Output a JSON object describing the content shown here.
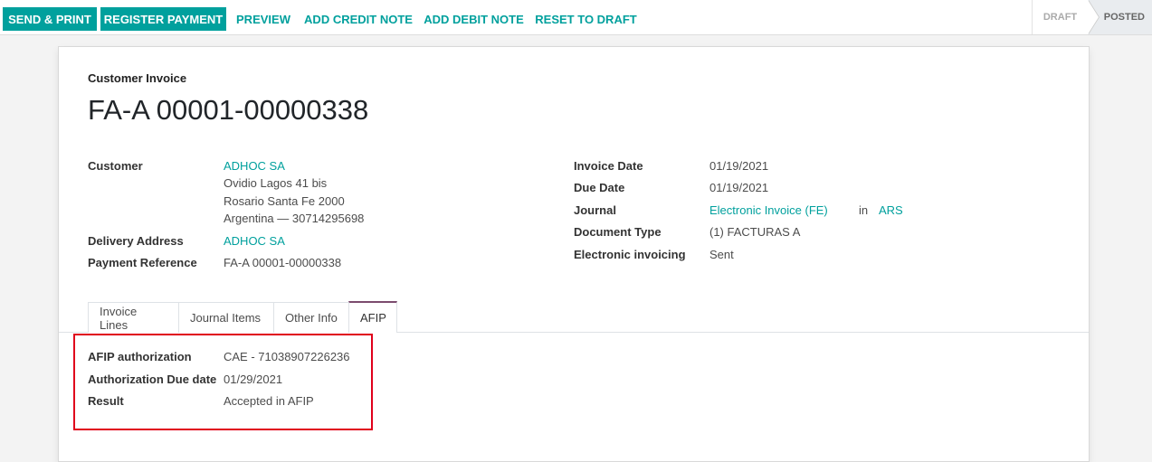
{
  "toolbar": {
    "send_print": "SEND & PRINT",
    "register_payment": "REGISTER PAYMENT",
    "preview": "PREVIEW",
    "add_credit_note": "ADD CREDIT NOTE",
    "add_debit_note": "ADD DEBIT NOTE",
    "reset_to_draft": "RESET TO DRAFT"
  },
  "status": {
    "stages": [
      "DRAFT",
      "POSTED"
    ],
    "current": "POSTED"
  },
  "invoice": {
    "kind": "Customer Invoice",
    "name": "FA-A 00001-00000338"
  },
  "left_fields": {
    "customer_label": "Customer",
    "customer_name": "ADHOC SA",
    "address_line1": "Ovidio Lagos 41 bis",
    "address_line2": "Rosario Santa Fe 2000",
    "address_line3": "Argentina — 30714295698",
    "delivery_label": "Delivery Address",
    "delivery_value": "ADHOC SA",
    "payment_ref_label": "Payment Reference",
    "payment_ref_value": "FA-A 00001-00000338"
  },
  "right_fields": {
    "invoice_date_label": "Invoice Date",
    "invoice_date_value": "01/19/2021",
    "due_date_label": "Due Date",
    "due_date_value": "01/19/2021",
    "journal_label": "Journal",
    "journal_value": "Electronic Invoice (FE)",
    "journal_in": "in",
    "currency": "ARS",
    "doc_type_label": "Document Type",
    "doc_type_value": "(1) FACTURAS A",
    "einvoicing_label": "Electronic invoicing",
    "einvoicing_value": "Sent"
  },
  "tabs": {
    "invoice_lines": "Invoice Lines",
    "journal_items": "Journal Items",
    "other_info": "Other Info",
    "afip": "AFIP",
    "active": "AFIP"
  },
  "afip": {
    "auth_label": "AFIP authorization",
    "auth_value": "CAE - 71038907226236",
    "due_label": "Authorization Due date",
    "due_value": "01/29/2021",
    "result_label": "Result",
    "result_value": "Accepted in AFIP"
  },
  "colors": {
    "accent": "#00a09d",
    "tab_active": "#7c4b6e",
    "highlight": "#e0001b"
  }
}
